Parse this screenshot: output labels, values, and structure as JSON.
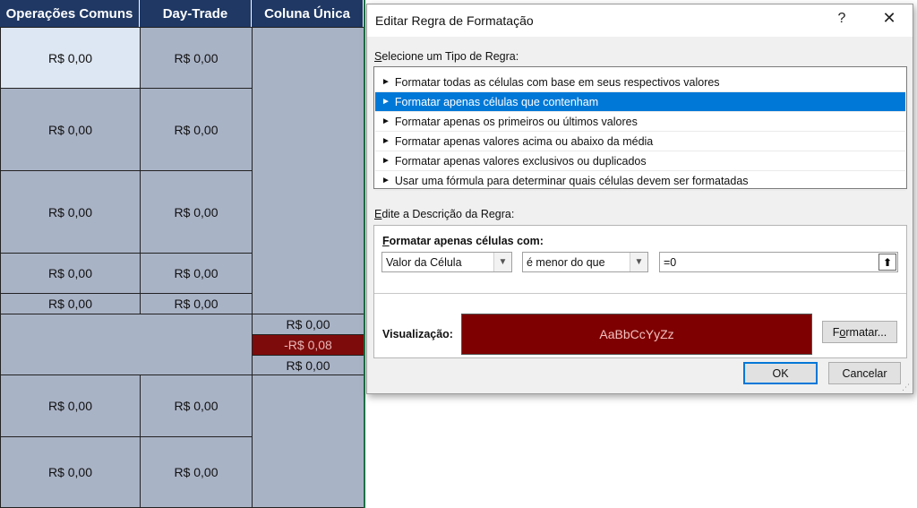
{
  "sheet": {
    "headers": [
      "Operações Comuns",
      "Day-Trade",
      "Coluna Única"
    ],
    "cells": {
      "r1c1": "R$ 0,00",
      "r1c2": "R$ 0,00",
      "r2c1": "R$ 0,00",
      "r2c2": "R$ 0,00",
      "r3c1": "R$ 0,00",
      "r3c2": "R$ 0,00",
      "r4c1": "R$ 0,00",
      "r4c2": "R$ 0,00",
      "r5c1": "R$ 0,00",
      "r5c2": "R$ 0,00",
      "u1": "R$ 0,00",
      "u2": "-R$ 0,08",
      "u3": "R$ 0,00",
      "r7c1": "R$ 0,00",
      "r7c2": "R$ 0,00",
      "r8c1": "R$ 0,00",
      "r8c2": "R$ 0,00"
    }
  },
  "dialog": {
    "title": "Editar Regra de Formatação",
    "help": "?",
    "close": "✕",
    "select_type_label_first": "S",
    "select_type_label_rest": "elecione um Tipo de Regra:",
    "rule_types": [
      "Formatar todas as células com base em seus respectivos valores",
      "Formatar apenas células que contenham",
      "Formatar apenas os primeiros ou últimos valores",
      "Formatar apenas valores acima ou abaixo da média",
      "Formatar apenas valores exclusivos ou duplicados",
      "Usar uma fórmula para determinar quais células devem ser formatadas"
    ],
    "rule_arrow": "►",
    "edit_desc_label_first": "E",
    "edit_desc_label_rest": "dite a Descrição da Regra:",
    "format_only_first": "F",
    "format_only_rest": "ormatar apenas células com:",
    "condition_field": "Valor da Célula",
    "operator": "é menor do que",
    "value": "=0",
    "collapse_icon": "⬆",
    "preview_label": "Visualização:",
    "preview_text": "AaBbCcYyZz",
    "format_button_pre": "F",
    "format_button_underline": "o",
    "format_button_post": "rmatar...",
    "ok": "OK",
    "cancel": "Cancelar",
    "dropdown_icon": "▼",
    "colors": {
      "preview_fill": "#7e0000",
      "selected_rule": "#0078d7",
      "header_fill": "#1f3864"
    }
  }
}
